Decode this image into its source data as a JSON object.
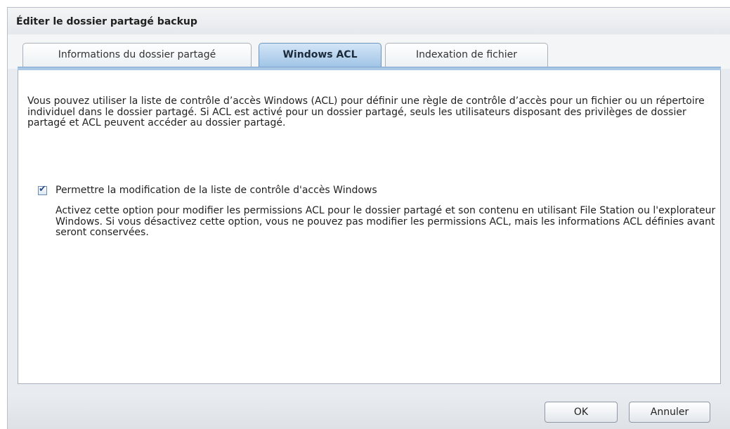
{
  "window": {
    "title": "Éditer le dossier partagé backup"
  },
  "tabs": [
    {
      "label": "Informations du dossier partagé",
      "active": false
    },
    {
      "label": "Windows ACL",
      "active": true
    },
    {
      "label": "Indexation de fichier",
      "active": false
    }
  ],
  "content": {
    "description": "Vous pouvez utiliser la liste de contrôle d’accès Windows (ACL) pour définir une règle de contrôle d’accès pour un fichier ou un répertoire individuel dans le dossier partagé. Si ACL est activé pour un dossier partagé, seuls les utilisateurs disposant des privilèges de dossier partagé et ACL peuvent accéder au dossier partagé.",
    "option": {
      "label": "Permettre la modification de la liste de contrôle d'accès Windows",
      "checked": true,
      "check_glyph": "✔",
      "description": "Activez cette option pour modifier les permissions ACL pour le dossier partagé et son contenu en utilisant File Station ou l'explorateur Windows. Si vous désactivez cette option, vous ne pouvez pas modifier les permissions ACL, mais les informations ACL définies avant seront conservées."
    }
  },
  "footer": {
    "ok_label": "OK",
    "cancel_label": "Annuler"
  },
  "colors": {
    "active_tab": "#9fc4e6",
    "window_bg": "#e8ebef",
    "content_bg": "#ffffff"
  }
}
